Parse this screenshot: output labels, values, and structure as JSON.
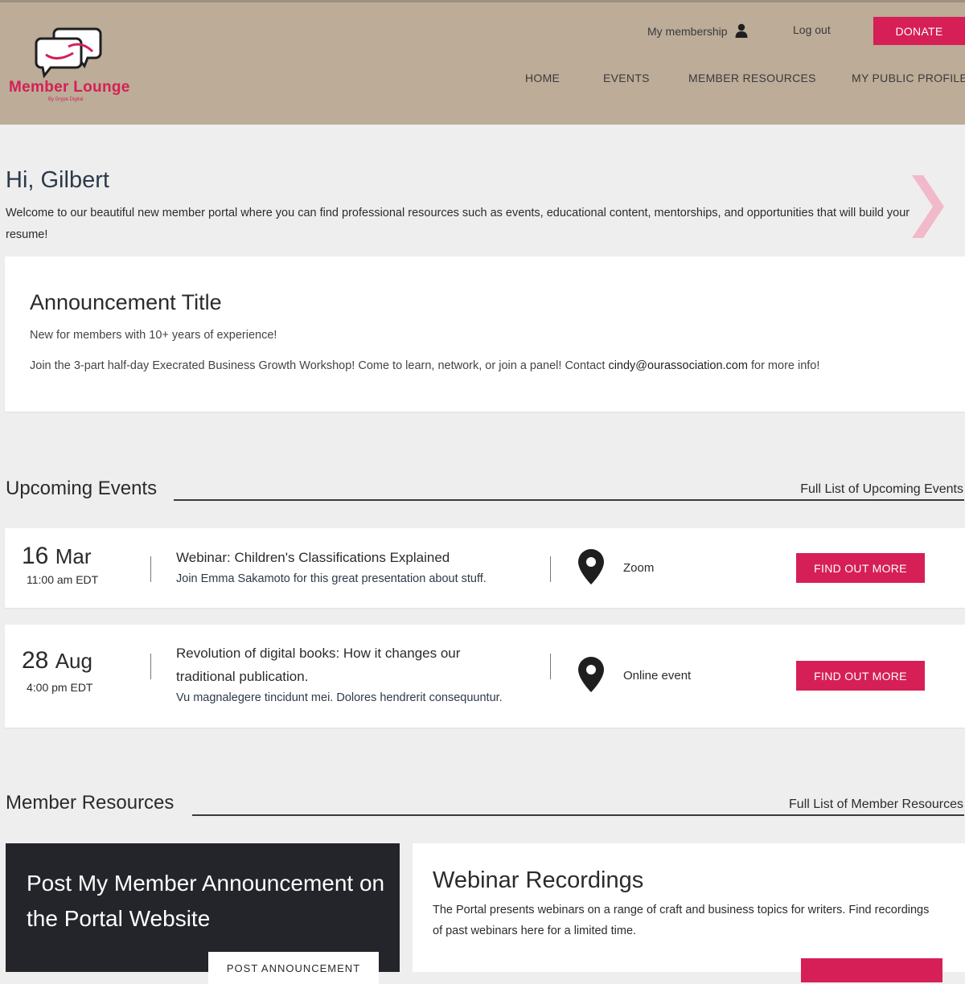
{
  "header": {
    "logo": {
      "name": "Member Lounge",
      "tagline": "By Grype Digital"
    },
    "utility": {
      "membership": "My membership",
      "logout": "Log out",
      "donate": "DONATE"
    },
    "nav": [
      "HOME",
      "EVENTS",
      "MEMBER RESOURCES",
      "MY PUBLIC PROFILE"
    ]
  },
  "greeting": {
    "title": "Hi, Gilbert",
    "intro": "Welcome to our beautiful new member portal where you can find professional resources such as events, educational content, mentorships, and opportunities that will build your resume!"
  },
  "announcement": {
    "title": "Announcement Title",
    "subtitle": "New for members with 10+ years of experience!",
    "body_before": "Join the 3-part half-day Execrated Business Growth Workshop! Come to learn, network, or join a panel! Contact ",
    "email": "cindy@ourassociation.com",
    "body_after": " for more info!"
  },
  "events": {
    "section_title": "Upcoming Events",
    "full_list_link": "Full List of Upcoming Events",
    "items": [
      {
        "day": "16",
        "month": "Mar",
        "time": "11:00 am EDT",
        "title": "Webinar: Children's Classifications Explained",
        "description": "Join Emma Sakamoto for this great presentation about stuff.",
        "location": "Zoom",
        "button": "FIND OUT MORE"
      },
      {
        "day": "28",
        "month": "Aug",
        "time": "4:00 pm EDT",
        "title": "Revolution of digital books: How it changes our traditional publication.",
        "description": "Vu magnalegere tincidunt mei. Dolores hendrerit consequuntur.",
        "location": "Online event",
        "button": "FIND OUT MORE"
      }
    ]
  },
  "resources": {
    "section_title": "Member Resources",
    "full_list_link": "Full List of Member Resources",
    "post_card": {
      "title": "Post My Member Announcement on the Portal Website",
      "button": "POST ANNOUNCEMENT"
    },
    "webinar_card": {
      "title": "Webinar Recordings",
      "description": "The Portal presents webinars on a range of craft and business topics for writers. Find recordings of past webinars here for a limited time."
    }
  },
  "colors": {
    "accent": "#d61f56",
    "header_bg": "#bcac98",
    "page_bg": "#eeeeee",
    "dark_card": "#23252a"
  }
}
